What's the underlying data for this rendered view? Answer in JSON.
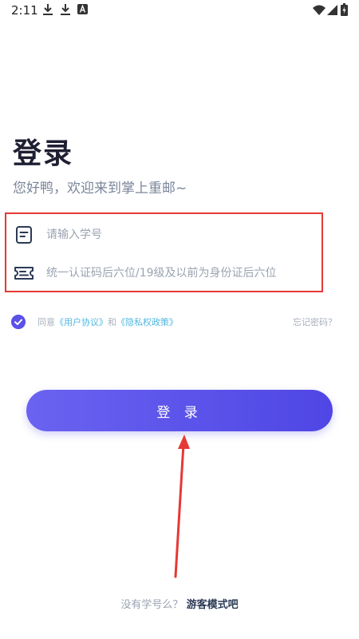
{
  "status_bar": {
    "time": "2:11",
    "icons": [
      "download-icon",
      "download-icon",
      "a-icon",
      "wifi-icon",
      "signal-icon",
      "battery-icon"
    ]
  },
  "header": {
    "title": "登录",
    "subtitle": "您好鸭，欢迎来到掌上重邮~"
  },
  "form": {
    "student_id": {
      "placeholder": "请输入学号",
      "value": "",
      "icon": "id-card-icon"
    },
    "password": {
      "placeholder": "统一认证码后六位/19级及以前为身份证后六位",
      "value": "",
      "icon": "ticket-icon"
    }
  },
  "agreement": {
    "checked": true,
    "prefix": "同意",
    "user_agreement": "《用户协议》",
    "and": "和",
    "privacy_policy": "《隐私权政策》",
    "forgot_password": "忘记密码？"
  },
  "login_button": {
    "label": "登 录"
  },
  "guest": {
    "prompt": "没有学号么？",
    "link": "游客模式吧"
  },
  "colors": {
    "primary": "#5a51e8",
    "link": "#4fb7e0",
    "highlight": "#e53935",
    "title": "#1f1f33"
  }
}
